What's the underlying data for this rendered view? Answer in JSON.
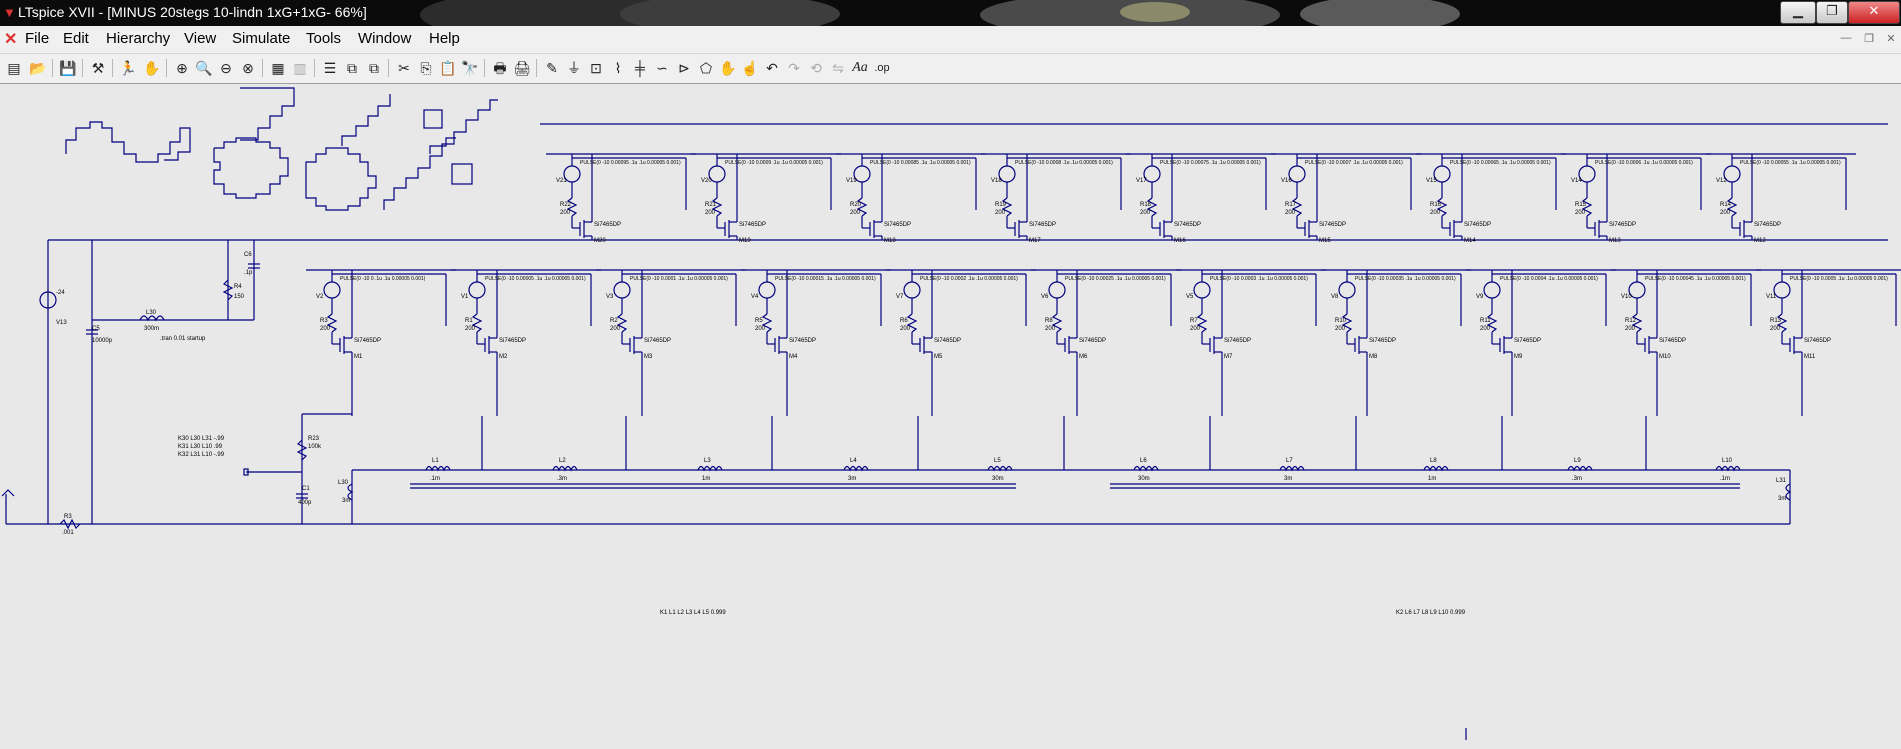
{
  "window": {
    "title": "LTspice XVII - [MINUS 20stegs 10-lindn 1xG+1xG- 66%]"
  },
  "menu": [
    {
      "label": "File"
    },
    {
      "label": "Edit"
    },
    {
      "label": "Hierarchy"
    },
    {
      "label": "View"
    },
    {
      "label": "Simulate"
    },
    {
      "label": "Tools"
    },
    {
      "label": "Window"
    },
    {
      "label": "Help"
    }
  ],
  "schematic": {
    "tran_directive": ".tran 0.01 startup",
    "k_directives": [
      "K30 L30 L31 -.99",
      "K31 L30 L10 .99",
      "K32 L31 L10 -.99"
    ],
    "k_bottom_left": "K1 L1 L2 L3 L4 L5  0.999",
    "k_bottom_right": "K2 L6 L7 L8 L9 L10 0.999",
    "src_left": {
      "name": "V13",
      "value": "-24"
    },
    "c5": {
      "name": "C5",
      "value": "10000p"
    },
    "c6": {
      "name": "C6",
      "value": ".1p"
    },
    "r4": {
      "name": "R4",
      "value": "150"
    },
    "l10": {
      "name": "L30",
      "value": "300m"
    },
    "r23": {
      "name": "R23",
      "value": "100k"
    },
    "c1": {
      "name": "C1",
      "value": "400p"
    },
    "l30": {
      "name": "L30",
      "value": "3m"
    },
    "r_bottom": {
      "name": "R3",
      "value": ".001"
    },
    "l31": {
      "name": "L31",
      "value": "3m"
    },
    "transistor_model": "Si7465DP",
    "upper_row": [
      {
        "v": "V21",
        "r": "R22",
        "m": "M20",
        "pulse": "PULSE(0 -10 0.00095 .1u .1u 0.00005 0.001)"
      },
      {
        "v": "V20",
        "r": "R21",
        "m": "M19",
        "pulse": "PULSE(0 -10 0.0009 .1u .1u 0.00005 0.001)"
      },
      {
        "v": "V19",
        "r": "R20",
        "m": "M18",
        "pulse": "PULSE(0 -10 0.00085 .1u .1u 0.00005 0.001)"
      },
      {
        "v": "V18",
        "r": "R19",
        "m": "M17",
        "pulse": "PULSE(0 -10 0.0008 .1u .1u 0.00005 0.001)"
      },
      {
        "v": "V17",
        "r": "R18",
        "m": "M16",
        "pulse": "PULSE(0 -10 0.00075 .1u .1u 0.00005 0.001)"
      },
      {
        "v": "V16",
        "r": "R17",
        "m": "M15",
        "pulse": "PULSE(0 -10 0.0007 .1u .1u 0.00005 0.001)"
      },
      {
        "v": "V15",
        "r": "R16",
        "m": "M14",
        "pulse": "PULSE(0 -10 0.00065 .1u .1u 0.00005 0.001)"
      },
      {
        "v": "V14",
        "r": "R15",
        "m": "M13",
        "pulse": "PULSE(0 -10 0.0006 .1u .1u 0.00005 0.001)"
      },
      {
        "v": "V12",
        "r": "R14",
        "m": "M12",
        "pulse": "PULSE(0 -10 0.00055 .1u .1u 0.00005 0.001)"
      }
    ],
    "lower_row": [
      {
        "v": "V2",
        "r": "R3",
        "m": "M1",
        "pulse": "PULSE(0 -10 0 .1u .1u 0.00005 0.001)"
      },
      {
        "v": "V1",
        "r": "R1",
        "m": "M2",
        "pulse": "PULSE(0 -10 0.00005 .1u .1u 0.00005 0.001)"
      },
      {
        "v": "V3",
        "r": "R2",
        "m": "M3",
        "pulse": "PULSE(0 -10 0.0001 .1u .1u 0.00005 0.001)"
      },
      {
        "v": "V4",
        "r": "R5",
        "m": "M4",
        "pulse": "PULSE(0 -10 0.00015 .1u .1u 0.00005 0.001)"
      },
      {
        "v": "V7",
        "r": "R6",
        "m": "M5",
        "pulse": "PULSE(0 -10 0.0002 .1u .1u 0.00005 0.001)"
      },
      {
        "v": "V6",
        "r": "R8",
        "m": "M6",
        "pulse": "PULSE(0 -10 0.00025 .1u .1u 0.00005 0.001)"
      },
      {
        "v": "V5",
        "r": "R7",
        "m": "M7",
        "pulse": "PULSE(0 -10 0.0003 .1u .1u 0.00005 0.001)"
      },
      {
        "v": "V8",
        "r": "R10",
        "m": "M8",
        "pulse": "PULSE(0 -10 0.00035 .1u .1u 0.00005 0.001)"
      },
      {
        "v": "V9",
        "r": "R11",
        "m": "M9",
        "pulse": "PULSE(0 -10 0.0004 .1u .1u 0.00005 0.001)"
      },
      {
        "v": "V10",
        "r": "R12",
        "m": "M10",
        "pulse": "PULSE(0 -10 0.00045 .1u .1u 0.00005 0.001)"
      },
      {
        "v": "V11",
        "r": "R13",
        "m": "M11",
        "pulse": "PULSE(0 -10 0.0005 .1u .1u 0.00005 0.001)"
      }
    ],
    "inductors": [
      {
        "name": "L1",
        "value": ".1m"
      },
      {
        "name": "L2",
        "value": ".3m"
      },
      {
        "name": "L3",
        "value": "1m"
      },
      {
        "name": "L4",
        "value": "3m"
      },
      {
        "name": "L5",
        "value": "30m"
      },
      {
        "name": "L6",
        "value": "30m"
      },
      {
        "name": "L7",
        "value": "3m"
      },
      {
        "name": "L8",
        "value": "1m"
      },
      {
        "name": "L9",
        "value": ".3m"
      },
      {
        "name": "L10",
        "value": ".1m"
      }
    ],
    "resistor_value": "200"
  }
}
